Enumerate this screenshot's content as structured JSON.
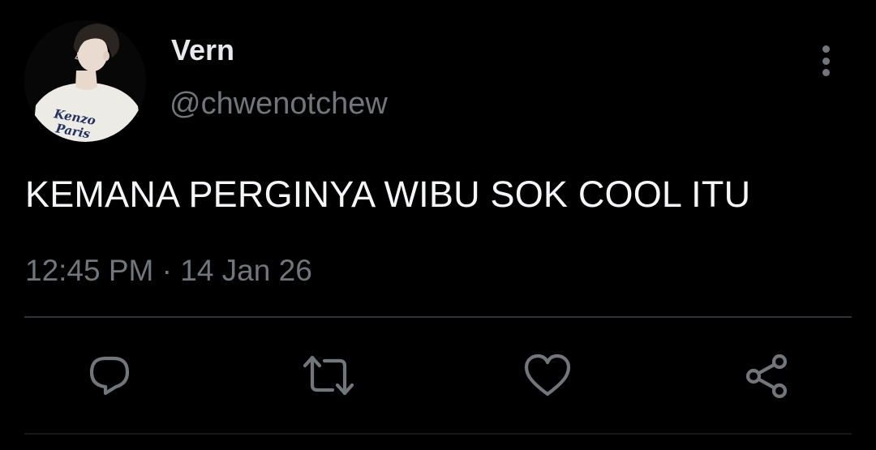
{
  "author": {
    "display_name": "Vern",
    "handle": "@chwenotchew",
    "avatar": {
      "icon": "profile-photo",
      "shirt_print": "Kenzo Paris"
    }
  },
  "tweet": {
    "text": "KEMANA PERGINYA WIBU SOK COOL ITU",
    "timestamp": "12:45 PM · 14 Jan 26"
  },
  "actions": [
    {
      "name": "reply",
      "icon": "reply-icon"
    },
    {
      "name": "retweet",
      "icon": "retweet-icon"
    },
    {
      "name": "like",
      "icon": "heart-icon"
    },
    {
      "name": "share",
      "icon": "share-icon"
    }
  ],
  "menu": {
    "icon": "more-vertical-icon"
  },
  "colors": {
    "background": "#000000",
    "primary_text": "#e7e9ea",
    "secondary_text": "#71767b",
    "divider": "#2f3336"
  }
}
